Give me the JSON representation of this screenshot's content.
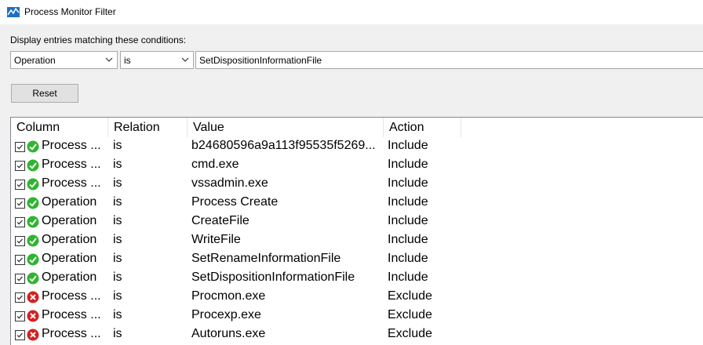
{
  "window": {
    "title": "Process Monitor Filter"
  },
  "filter_form": {
    "conditions_label": "Display entries matching these conditions:",
    "column_value": "Operation",
    "relation_value": "is",
    "value_text": "SetDispositionInformationFile",
    "reset_label": "Reset"
  },
  "list": {
    "headers": [
      "Column",
      "Relation",
      "Value",
      "Action"
    ],
    "rows": [
      {
        "checked": true,
        "status": "include",
        "column": "Process ...",
        "relation": "is",
        "value": "b24680596a9a113f95535f5269...",
        "action": "Include"
      },
      {
        "checked": true,
        "status": "include",
        "column": "Process ...",
        "relation": "is",
        "value": "cmd.exe",
        "action": "Include"
      },
      {
        "checked": true,
        "status": "include",
        "column": "Process ...",
        "relation": "is",
        "value": "vssadmin.exe",
        "action": "Include"
      },
      {
        "checked": true,
        "status": "include",
        "column": "Operation",
        "relation": "is",
        "value": "Process Create",
        "action": "Include"
      },
      {
        "checked": true,
        "status": "include",
        "column": "Operation",
        "relation": "is",
        "value": "CreateFile",
        "action": "Include"
      },
      {
        "checked": true,
        "status": "include",
        "column": "Operation",
        "relation": "is",
        "value": "WriteFile",
        "action": "Include"
      },
      {
        "checked": true,
        "status": "include",
        "column": "Operation",
        "relation": "is",
        "value": "SetRenameInformationFile",
        "action": "Include"
      },
      {
        "checked": true,
        "status": "include",
        "column": "Operation",
        "relation": "is",
        "value": "SetDispositionInformationFile",
        "action": "Include"
      },
      {
        "checked": true,
        "status": "exclude",
        "column": "Process ...",
        "relation": "is",
        "value": "Procmon.exe",
        "action": "Exclude"
      },
      {
        "checked": true,
        "status": "exclude",
        "column": "Process ...",
        "relation": "is",
        "value": "Procexp.exe",
        "action": "Exclude"
      },
      {
        "checked": true,
        "status": "exclude",
        "column": "Process ...",
        "relation": "is",
        "value": "Autoruns.exe",
        "action": "Exclude"
      }
    ]
  },
  "colors": {
    "include": "#2fb52f",
    "exclude": "#d42020",
    "app_icon": "#1e6fc2"
  },
  "icons": {
    "app": "process-monitor-icon",
    "include": "check-circle-icon",
    "exclude": "x-circle-icon",
    "dropdown": "chevron-down-icon",
    "checkbox": "checkbox-icon"
  }
}
